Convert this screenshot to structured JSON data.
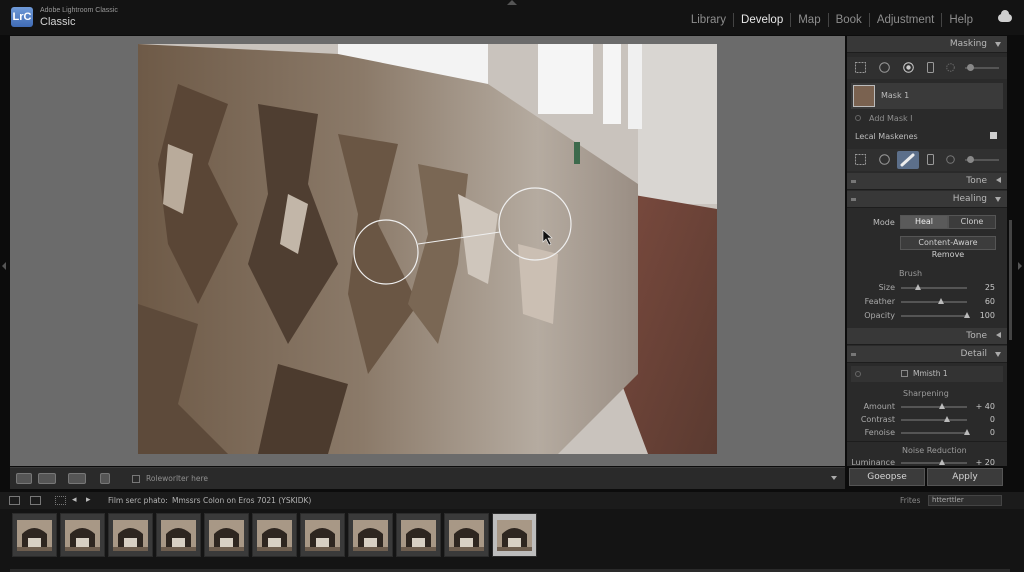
{
  "app": {
    "logo_text": "LrC",
    "subtitle": "Adobe Lightroom Classic",
    "name": "Classic"
  },
  "modules": [
    {
      "label": "Library",
      "active": false
    },
    {
      "label": "Develop",
      "active": true
    },
    {
      "label": "Map",
      "active": false
    },
    {
      "label": "Book",
      "active": false
    },
    {
      "label": "Adjustment",
      "active": false
    },
    {
      "label": "Help",
      "active": false
    }
  ],
  "icons": {
    "cloud": "cloud-icon",
    "brush": "brush-icon",
    "mask_thumb": "mask-thumbnail-icon"
  },
  "panel": {
    "masking_title": "Masking",
    "mask1_label": "Mask 1",
    "add_mask_label": "Add Mask I",
    "local_masks_label": "Lecal Maskenes",
    "tone_title": "Tone",
    "healing_title": "Healing",
    "mode_label": "Mode",
    "heal_button": "Heal",
    "clone_button": "Clone",
    "content_aware_button": "Content-Aware Remove",
    "brush_label": "Brush",
    "size_label": "Size",
    "size_value": "25",
    "feather_label": "Feather",
    "feather_value": "60",
    "opacity_label": "Opacity",
    "opacity_value": "100",
    "tone2_title": "Tone",
    "detail_title": "Detail",
    "mask_sub_label": "Mmisth 1",
    "sharpening_label": "Sharpening",
    "amount_label": "Amount",
    "amount_value": "+ 40",
    "contrast_label": "Contrast",
    "contrast_value": "0",
    "fenoise_label": "Fenoise",
    "fenoise_value": "0",
    "noise_label": "Noise Reduction",
    "luminance_label": "Luminance",
    "luminance_value": "+ 20"
  },
  "slider_levels": {
    "size": 0.25,
    "feather": 0.6,
    "opacity": 1.0,
    "amount": 0.62,
    "contrast": 0.7,
    "fenoise": 1.0,
    "luminance": 0.62
  },
  "bottom_buttons": {
    "left": "Goeopse",
    "right": "Apply"
  },
  "toolstrip": {
    "label": "Roleworlter here"
  },
  "filmstrip": {
    "label": "Film serc phato:",
    "path": "Mmssrs Colon on Eros 7021 (YSKIDK)",
    "filter_label": "Frites",
    "filter_value": "htterttler",
    "thumb_count": 11,
    "selected_index": 10
  }
}
